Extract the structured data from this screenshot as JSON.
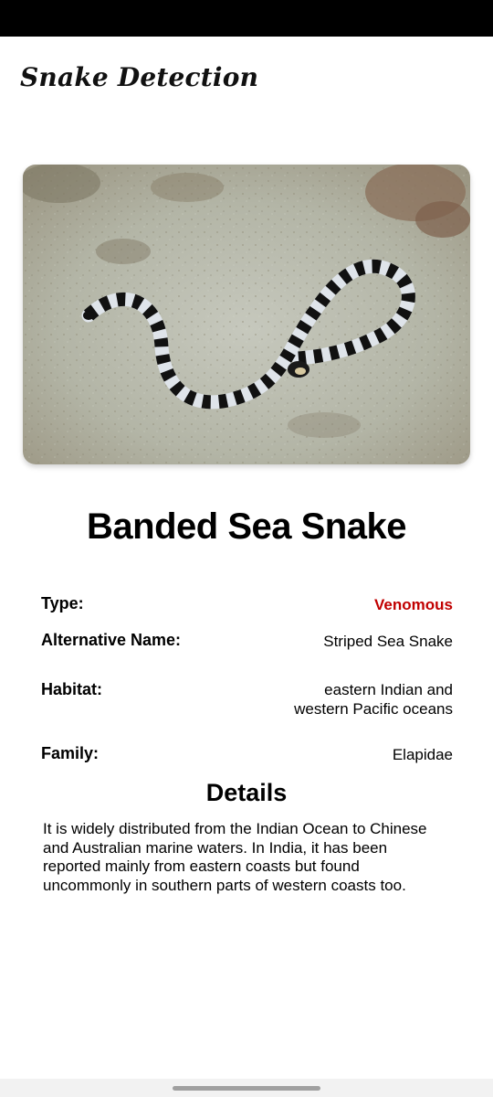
{
  "app": {
    "title": "Snake Detection"
  },
  "snake": {
    "name": "Banded Sea Snake",
    "image_alt_icon": "snake-photo"
  },
  "info": {
    "type_label": "Type:",
    "type_value": "Venomous",
    "alt_name_label": "Alternative Name:",
    "alt_name_value": "Striped Sea Snake",
    "habitat_label": "Habitat:",
    "habitat_value_line1": "eastern Indian and",
    "habitat_value_line2": "western Pacific oceans",
    "family_label": "Family:",
    "family_value": "Elapidae"
  },
  "details": {
    "title": "Details",
    "text": "It is widely distributed from the Indian Ocean to Chinese and Australian marine waters. In India, it has been reported mainly from eastern coasts but found uncommonly in southern parts of western coasts too."
  },
  "colors": {
    "venomous": "#c10000",
    "status_bar": "#000000",
    "nav_bar": "#f2f2f2"
  }
}
